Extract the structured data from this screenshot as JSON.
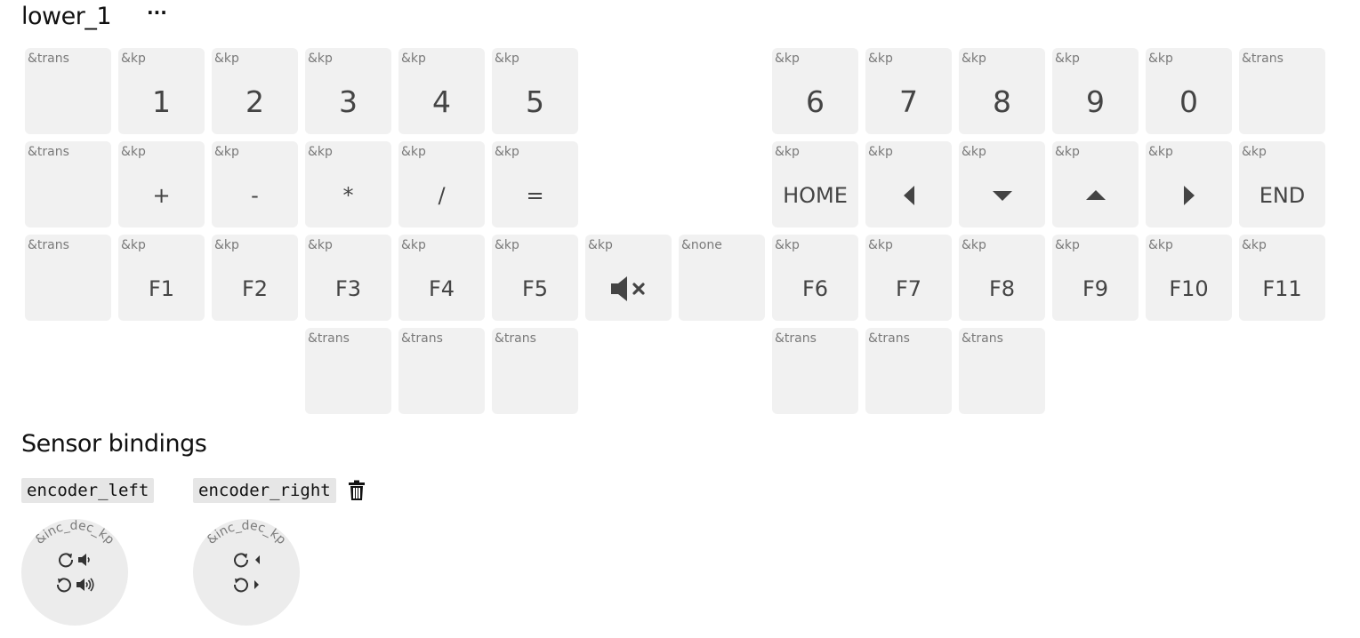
{
  "layer": {
    "name": "lower_1",
    "menu_label": "···"
  },
  "rows": [
    [
      {
        "binding": "&trans",
        "param": "",
        "icon": ""
      },
      {
        "binding": "&kp",
        "param": "1",
        "icon": ""
      },
      {
        "binding": "&kp",
        "param": "2",
        "icon": ""
      },
      {
        "binding": "&kp",
        "param": "3",
        "icon": ""
      },
      {
        "binding": "&kp",
        "param": "4",
        "icon": ""
      },
      {
        "binding": "&kp",
        "param": "5",
        "icon": ""
      },
      {
        "binding": "&kp",
        "param": "6",
        "icon": ""
      },
      {
        "binding": "&kp",
        "param": "7",
        "icon": ""
      },
      {
        "binding": "&kp",
        "param": "8",
        "icon": ""
      },
      {
        "binding": "&kp",
        "param": "9",
        "icon": ""
      },
      {
        "binding": "&kp",
        "param": "0",
        "icon": ""
      },
      {
        "binding": "&trans",
        "param": "",
        "icon": ""
      }
    ],
    [
      {
        "binding": "&trans",
        "param": "",
        "icon": ""
      },
      {
        "binding": "&kp",
        "param": "+",
        "icon": ""
      },
      {
        "binding": "&kp",
        "param": "-",
        "icon": ""
      },
      {
        "binding": "&kp",
        "param": "*",
        "icon": ""
      },
      {
        "binding": "&kp",
        "param": "/",
        "icon": ""
      },
      {
        "binding": "&kp",
        "param": "=",
        "icon": ""
      },
      {
        "binding": "&kp",
        "param": "HOME",
        "icon": ""
      },
      {
        "binding": "&kp",
        "param": "",
        "icon": "caret-left-icon"
      },
      {
        "binding": "&kp",
        "param": "",
        "icon": "caret-down-icon"
      },
      {
        "binding": "&kp",
        "param": "",
        "icon": "caret-up-icon"
      },
      {
        "binding": "&kp",
        "param": "",
        "icon": "caret-right-icon"
      },
      {
        "binding": "&kp",
        "param": "END",
        "icon": ""
      }
    ],
    [
      {
        "binding": "&trans",
        "param": "",
        "icon": ""
      },
      {
        "binding": "&kp",
        "param": "F1",
        "icon": ""
      },
      {
        "binding": "&kp",
        "param": "F2",
        "icon": ""
      },
      {
        "binding": "&kp",
        "param": "F3",
        "icon": ""
      },
      {
        "binding": "&kp",
        "param": "F4",
        "icon": ""
      },
      {
        "binding": "&kp",
        "param": "F5",
        "icon": ""
      },
      {
        "binding": "&kp",
        "param": "",
        "icon": "volume-mute-icon"
      },
      {
        "binding": "&none",
        "param": "",
        "icon": ""
      },
      {
        "binding": "&kp",
        "param": "F6",
        "icon": ""
      },
      {
        "binding": "&kp",
        "param": "F7",
        "icon": ""
      },
      {
        "binding": "&kp",
        "param": "F8",
        "icon": ""
      },
      {
        "binding": "&kp",
        "param": "F9",
        "icon": ""
      },
      {
        "binding": "&kp",
        "param": "F10",
        "icon": ""
      },
      {
        "binding": "&kp",
        "param": "F11",
        "icon": ""
      }
    ],
    [
      {
        "binding": "&trans",
        "param": "",
        "icon": ""
      },
      {
        "binding": "&trans",
        "param": "",
        "icon": ""
      },
      {
        "binding": "&trans",
        "param": "",
        "icon": ""
      },
      {
        "binding": "&trans",
        "param": "",
        "icon": ""
      },
      {
        "binding": "&trans",
        "param": "",
        "icon": ""
      },
      {
        "binding": "&trans",
        "param": "",
        "icon": ""
      }
    ]
  ],
  "sensors": {
    "title": "Sensor bindings",
    "encoders": [
      {
        "name": "encoder_left",
        "behavior": "&inc_dec_kp",
        "cw_icon": "volume-down-icon",
        "ccw_icon": "volume-up-icon",
        "deletable": false
      },
      {
        "name": "encoder_right",
        "behavior": "&inc_dec_kp",
        "cw_icon": "caret-left-icon",
        "ccw_icon": "caret-right-icon",
        "deletable": true
      }
    ],
    "delete_icon": "trash-icon"
  },
  "colors": {
    "key_bg": "#f1f1f1",
    "binding_text": "#7a7a7a",
    "param_text": "#444444",
    "icon": "#444444",
    "label_bg": "#e6e6e6",
    "knob_bg": "#ececec"
  }
}
